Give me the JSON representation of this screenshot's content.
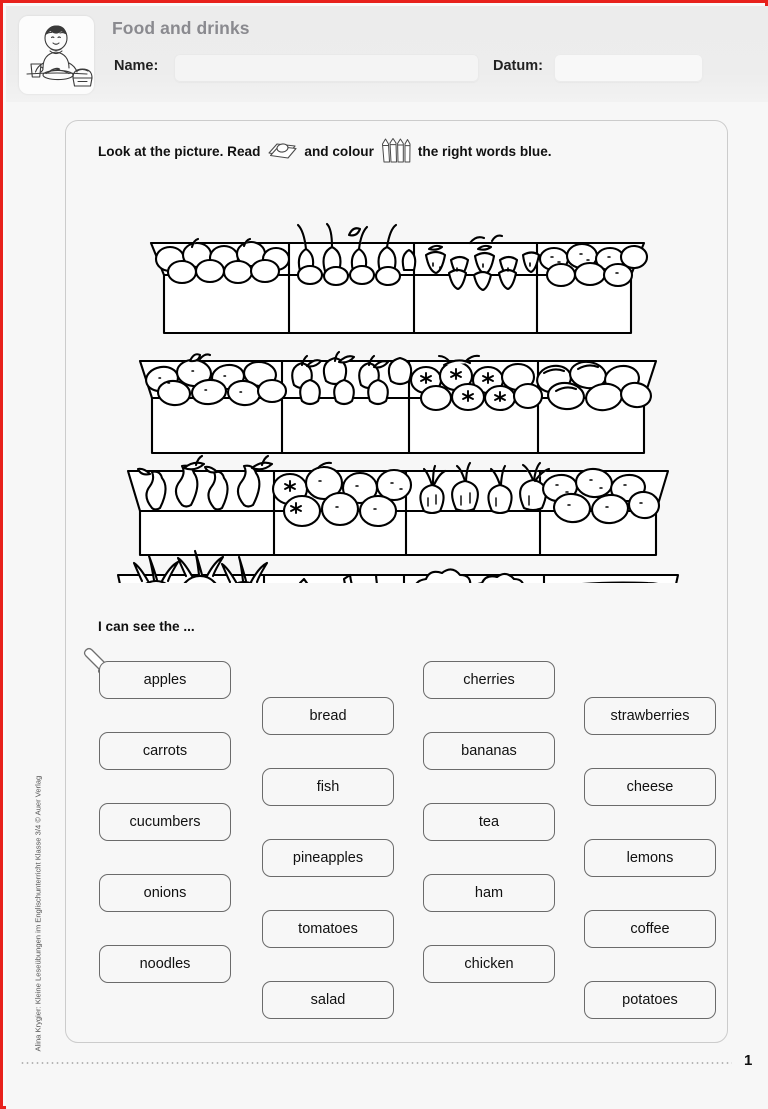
{
  "header": {
    "title": "Food and drinks",
    "name_label": "Name:",
    "name_value": "",
    "name_placeholder": "",
    "datum_label": "Datum:",
    "datum_value": "",
    "datum_placeholder": "",
    "icon": "child-eating-icon"
  },
  "instruction": {
    "part1": "Look at the picture. Read",
    "icon1": "book-icon",
    "part2": "and colour",
    "icon2": "coloured-pencils-icon",
    "part3": "the right words blue."
  },
  "illustration": {
    "name": "market-stall-line-drawing",
    "description": "Black and white line drawing of a market stall with four tiers of crates of fruit and vegetables",
    "rows": [
      {
        "row": 1,
        "crates": [
          "potatoes",
          "peppers",
          "strawberries",
          "potatoes"
        ]
      },
      {
        "row": 2,
        "crates": [
          "lemons",
          "apples",
          "tomatoes",
          "peaches"
        ]
      },
      {
        "row": 3,
        "crates": [
          "pears",
          "oranges",
          "onions",
          "potatoes"
        ]
      },
      {
        "row": 4,
        "crates": [
          "pineapples",
          "bananas",
          "cauliflower",
          "bananas"
        ]
      }
    ]
  },
  "task": {
    "subhead": "I can see the ...",
    "marker_icon": "paintbrush-icon",
    "columns": [
      {
        "index": 1,
        "words": [
          "apples",
          "carrots",
          "cucumbers",
          "onions",
          "noodles"
        ]
      },
      {
        "index": 2,
        "words": [
          "bread",
          "fish",
          "pineapples",
          "tomatoes",
          "salad"
        ]
      },
      {
        "index": 3,
        "words": [
          "cherries",
          "bananas",
          "tea",
          "ham",
          "chicken"
        ]
      },
      {
        "index": 4,
        "words": [
          "strawberries",
          "cheese",
          "lemons",
          "coffee",
          "potatoes"
        ]
      }
    ]
  },
  "footer": {
    "page_number": "1",
    "copyright": "Alina Krygier: Kleine Leseübungen im Englischunterricht Klasse 3/4 © Auer Verlag"
  },
  "colors": {
    "frame": "#e8211c",
    "header_bg": "#ededed",
    "title_text": "#8a8a8f",
    "panel_border": "#cccccc",
    "box_border": "#6b6b6b",
    "text": "#111111"
  }
}
